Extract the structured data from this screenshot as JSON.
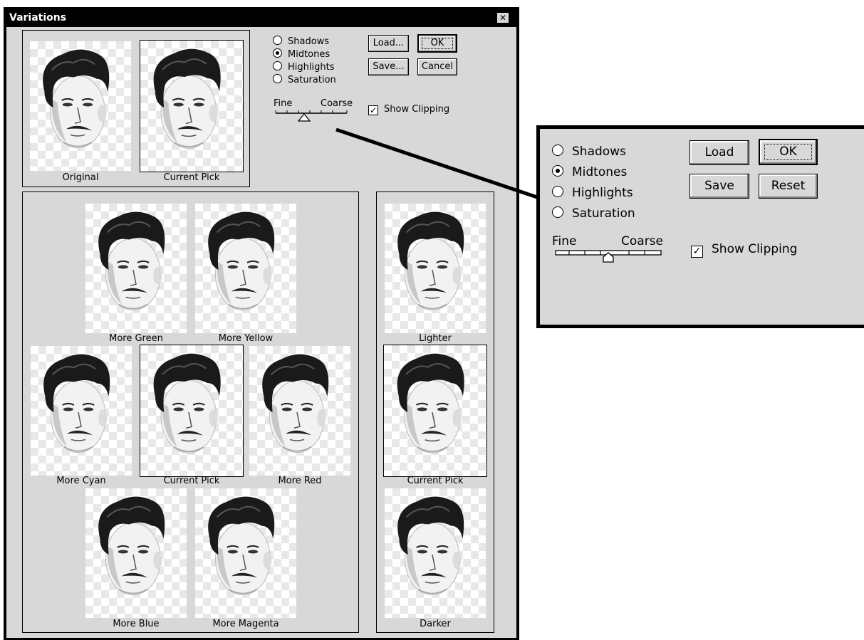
{
  "dialog": {
    "title": "Variations",
    "close_glyph": "✕"
  },
  "top_panel": {
    "original_label": "Original",
    "current_pick_label": "Current Pick"
  },
  "controls": {
    "radios": [
      {
        "label": "Shadows",
        "selected": false
      },
      {
        "label": "Midtones",
        "selected": true
      },
      {
        "label": "Highlights",
        "selected": false
      },
      {
        "label": "Saturation",
        "selected": false
      }
    ],
    "buttons": {
      "load": "Load...",
      "ok": "OK",
      "save": "Save...",
      "cancel": "Cancel"
    },
    "slider": {
      "fine_label": "Fine",
      "coarse_label": "Coarse",
      "value": 0.5
    },
    "show_clipping": {
      "label": "Show Clipping",
      "checked": true
    }
  },
  "color_grid": {
    "more_green": "More Green",
    "more_yellow": "More Yellow",
    "more_cyan": "More Cyan",
    "current_pick": "Current Pick",
    "more_red": "More Red",
    "more_blue": "More Blue",
    "more_magenta": "More Magenta"
  },
  "brightness": {
    "lighter": "Lighter",
    "current_pick": "Current Pick",
    "darker": "Darker"
  },
  "callout": {
    "radios": [
      {
        "label": "Shadows",
        "selected": false
      },
      {
        "label": "Midtones",
        "selected": true
      },
      {
        "label": "Highlights",
        "selected": false
      },
      {
        "label": "Saturation",
        "selected": false
      }
    ],
    "buttons": {
      "load": "Load",
      "ok": "OK",
      "save": "Save",
      "reset": "Reset"
    },
    "slider": {
      "fine_label": "Fine",
      "coarse_label": "Coarse",
      "value": 0.5
    },
    "show_clipping": {
      "label": "Show Clipping",
      "checked": true
    }
  },
  "icons": {
    "thumbnail": "portrait-thumbnail-icon",
    "close": "close-icon"
  },
  "colors": {
    "title_bar": "#000000",
    "dialog_bg": "#d8d8d8",
    "checker": "#e8e8e8"
  }
}
